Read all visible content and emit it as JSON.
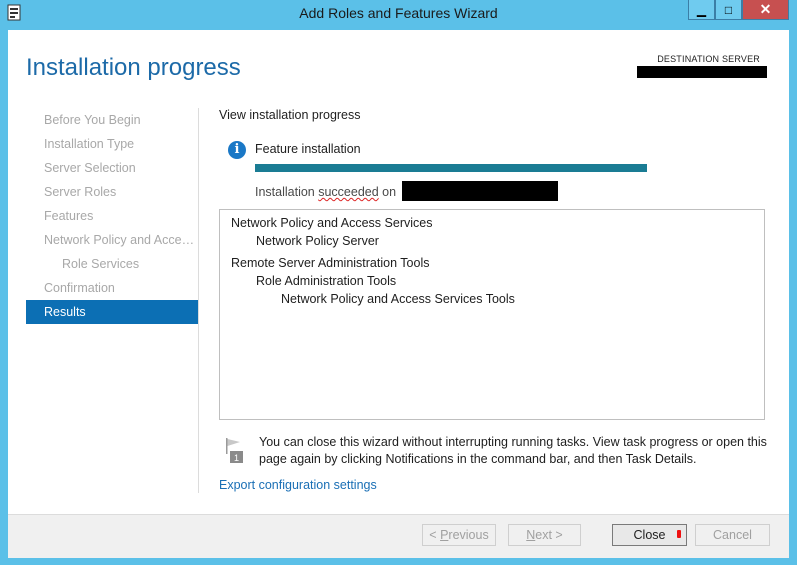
{
  "window": {
    "title": "Add Roles and Features Wizard",
    "minimize_glyph": "▁",
    "maximize_glyph": "□",
    "close_glyph": "✕"
  },
  "header": {
    "page_title": "Installation progress",
    "destination_label": "DESTINATION SERVER"
  },
  "nav": {
    "items": [
      {
        "label": "Before You Begin"
      },
      {
        "label": "Installation Type"
      },
      {
        "label": "Server Selection"
      },
      {
        "label": "Server Roles"
      },
      {
        "label": "Features"
      },
      {
        "label": "Network Policy and Acces..."
      },
      {
        "label": "Role Services"
      },
      {
        "label": "Confirmation"
      },
      {
        "label": "Results"
      }
    ]
  },
  "main": {
    "section_label": "View installation progress",
    "feature_label": "Feature installation",
    "progress_percent": 100,
    "status_prefix": "Installation ",
    "status_word": "succeeded",
    "status_suffix": " on",
    "results": [
      "Network Policy and Access Services",
      "Network Policy Server",
      "Remote Server Administration Tools",
      "Role Administration Tools",
      "Network Policy and Access Services Tools"
    ],
    "note_badge": "1",
    "note_text": "You can close this wizard without interrupting running tasks. View task progress or open this page again by clicking Notifications in the command bar, and then Task Details.",
    "export_link": "Export configuration settings"
  },
  "footer": {
    "previous_pre": "< ",
    "previous_accel": "P",
    "previous_rest": "revious",
    "next_accel": "N",
    "next_rest": "ext >",
    "close_label": "Close",
    "cancel_label": "Cancel"
  }
}
